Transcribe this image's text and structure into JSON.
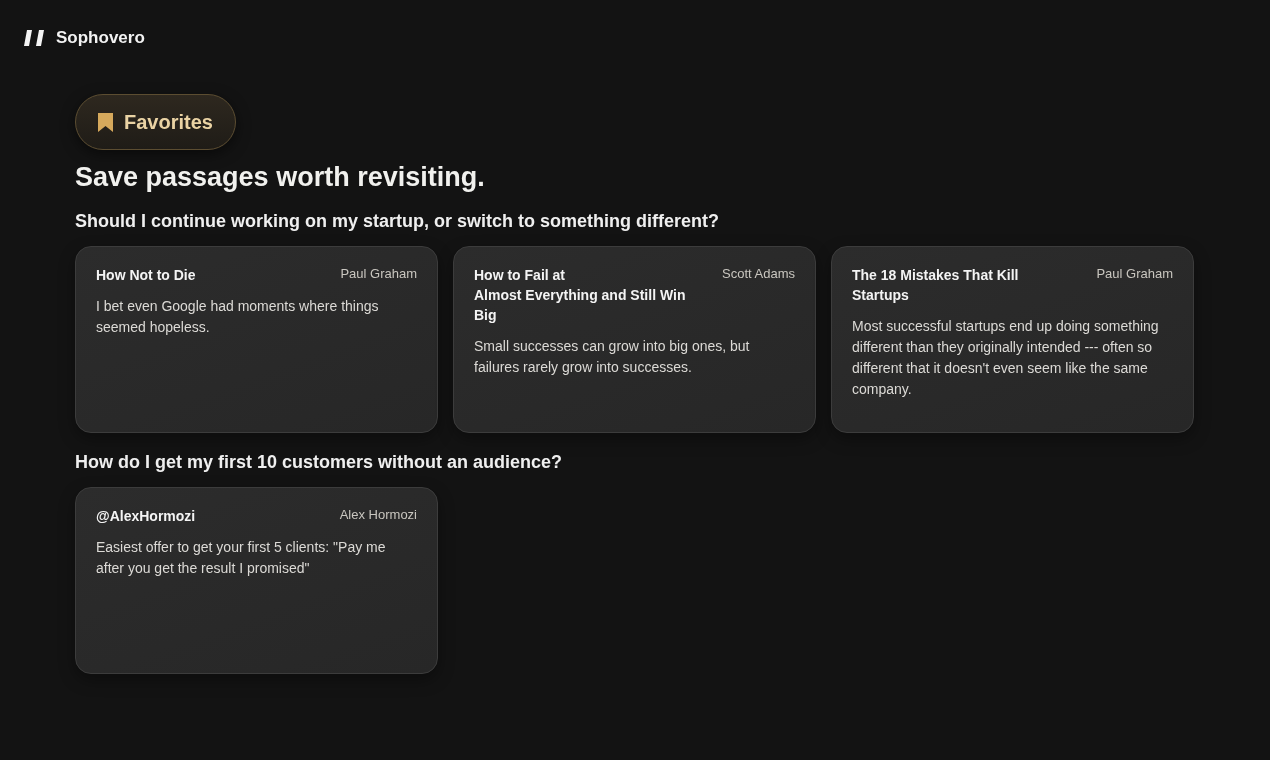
{
  "brand": {
    "name": "Sophovero"
  },
  "section": {
    "label": "Favorites",
    "heading": "Save passages worth revisiting."
  },
  "groups": [
    {
      "question": "Should I continue working on my startup, or switch to something different?",
      "passages": [
        {
          "title": "How Not to Die",
          "author": "Paul Graham",
          "excerpt": "I bet even Google had moments where things seemed hopeless."
        },
        {
          "title": "How to Fail at\nAlmost Everything and Still Win Big",
          "author": "Scott Adams",
          "excerpt": "Small successes can grow into big ones, but failures rarely grow into successes."
        },
        {
          "title": "The 18 Mistakes That Kill Startups",
          "author": "Paul Graham",
          "excerpt": "Most successful startups end up doing something different than they originally intended --- often so different that it doesn't even seem like the same company."
        }
      ]
    },
    {
      "question": "How do I get my first 10 customers without an audience?",
      "passages": [
        {
          "title": "@AlexHormozi",
          "author": "Alex Hormozi",
          "excerpt": "Easiest offer to get your first 5 clients: \"Pay me after you get the result I promised\""
        }
      ]
    }
  ]
}
